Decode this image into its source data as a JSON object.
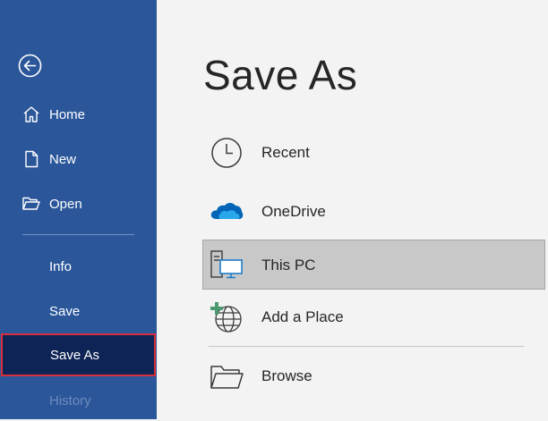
{
  "sidebar": {
    "items": [
      {
        "label": "Home",
        "icon": "home-icon"
      },
      {
        "label": "New",
        "icon": "new-document-icon"
      },
      {
        "label": "Open",
        "icon": "open-folder-icon"
      },
      {
        "label": "Info"
      },
      {
        "label": "Save"
      },
      {
        "label": "Save As",
        "state": "active"
      },
      {
        "label": "History",
        "state": "disabled"
      }
    ],
    "background": "#2b579a",
    "active_background": "#0e2356",
    "highlight_border": "#d6303a"
  },
  "main": {
    "title": "Save As",
    "locations": [
      {
        "label": "Recent",
        "icon": "clock-icon"
      },
      {
        "label": "OneDrive",
        "icon": "cloud-icon"
      },
      {
        "label": "This PC",
        "icon": "computer-icon",
        "state": "selected"
      },
      {
        "label": "Add a Place",
        "icon": "globe-add-icon"
      },
      {
        "label": "Browse",
        "icon": "folder-icon"
      }
    ]
  }
}
